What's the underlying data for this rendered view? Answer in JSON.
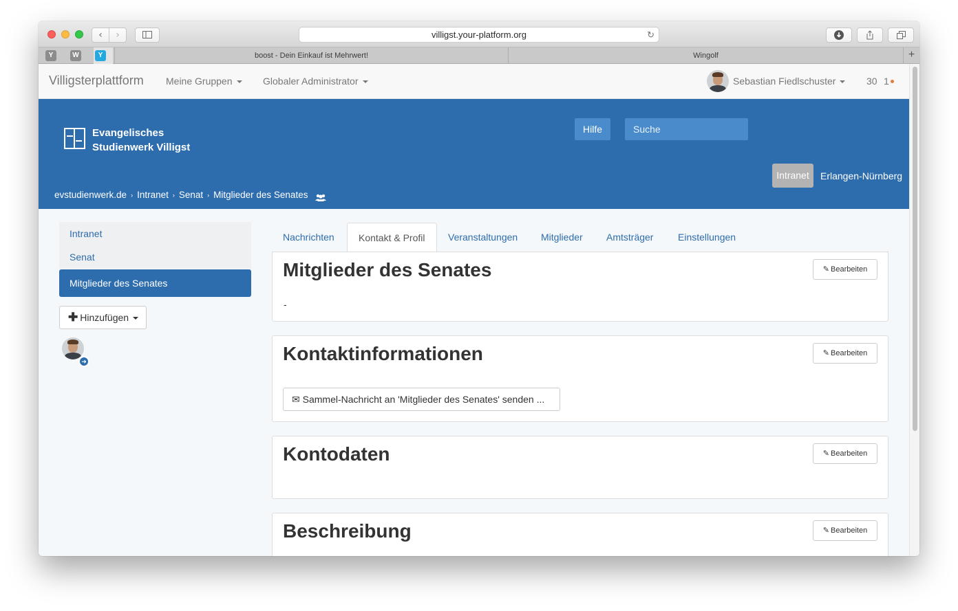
{
  "browser": {
    "url": "villigst.your-platform.org",
    "favicons": [
      "Y",
      "W",
      "Y"
    ],
    "tabs": [
      "boost - Dein Einkauf ist Mehrwert!",
      "Wingolf"
    ],
    "new_tab": "+"
  },
  "navbar": {
    "brand": "Villigsterplattform",
    "menu_groups": "Meine Gruppen",
    "menu_admin": "Globaler Administrator",
    "user_name": "Sebastian Fiedlschuster",
    "count": "30",
    "notifications": "1"
  },
  "header": {
    "logo_line1": "Evangelisches",
    "logo_line2": "Studienwerk Villigst",
    "help_button": "Hilfe",
    "search_placeholder": "Suche",
    "pill_intranet": "Intranet",
    "pill_region": "Erlangen-Nürnberg",
    "breadcrumb": [
      "evstudienwerk.de",
      "Intranet",
      "Senat",
      "Mitglieder des Senates"
    ]
  },
  "sidebar": {
    "items": [
      "Intranet",
      "Senat"
    ],
    "active_item": "Mitglieder des Senates",
    "add_button": "Hinzufügen"
  },
  "tabs": [
    "Nachrichten",
    "Kontakt & Profil",
    "Veranstaltungen",
    "Mitglieder",
    "Amtsträger",
    "Einstellungen"
  ],
  "active_tab": "Kontakt & Profil",
  "panels": {
    "title": "Mitglieder des Senates",
    "title_value": "-",
    "contact": "Kontaktinformationen",
    "contact_button": "Sammel-Nachricht an 'Mitglieder des Senates' senden ...",
    "account": "Kontodaten",
    "description": "Beschreibung",
    "edit_label": "Bearbeiten"
  },
  "colors": {
    "brand_blue": "#2d6cad",
    "accent_light": "#4a8ccb",
    "notification": "#e57b3a"
  }
}
